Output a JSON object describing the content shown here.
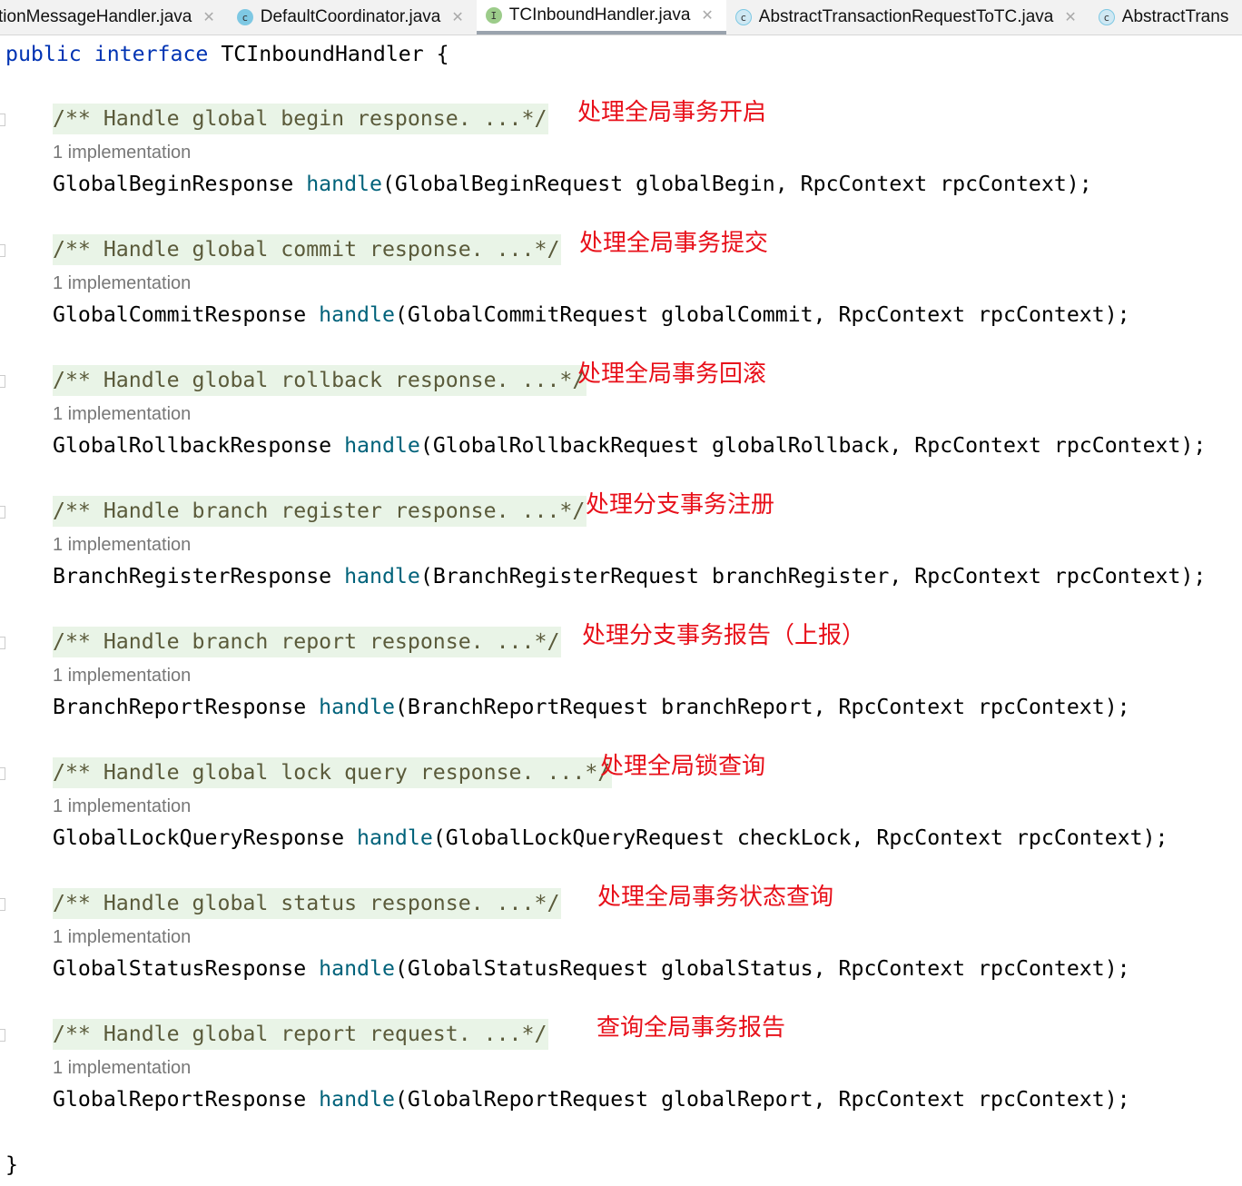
{
  "tabs": [
    {
      "label": "tionMessageHandler.java",
      "icon": "none",
      "active": false
    },
    {
      "label": "DefaultCoordinator.java",
      "icon": "c",
      "active": false
    },
    {
      "label": "TCInboundHandler.java",
      "icon": "i",
      "active": true
    },
    {
      "label": "AbstractTransactionRequestToTC.java",
      "icon": "ca",
      "active": false
    },
    {
      "label": "AbstractTrans",
      "icon": "ca",
      "active": false
    }
  ],
  "code": {
    "kw_public": "public",
    "kw_interface": "interface",
    "iface": " TCInboundHandler {",
    "close": "}",
    "impl_label": "1 implementation",
    "methods": [
      {
        "comment": "/** Handle global begin response. ...*/",
        "ret": "GlobalBeginResponse ",
        "name": "handle",
        "params": "(GlobalBeginRequest globalBegin, RpcContext rpcContext);",
        "note": "处理全局事务开启"
      },
      {
        "comment": "/** Handle global commit response. ...*/",
        "ret": "GlobalCommitResponse ",
        "name": "handle",
        "params": "(GlobalCommitRequest globalCommit, RpcContext rpcContext);",
        "note": "处理全局事务提交"
      },
      {
        "comment": "/** Handle global rollback response. ...*/",
        "ret": "GlobalRollbackResponse ",
        "name": "handle",
        "params": "(GlobalRollbackRequest globalRollback, RpcContext rpcContext);",
        "note": "处理全局事务回滚"
      },
      {
        "comment": "/** Handle branch register response. ...*/",
        "ret": "BranchRegisterResponse ",
        "name": "handle",
        "params": "(BranchRegisterRequest branchRegister, RpcContext rpcContext);",
        "note": "处理分支事务注册"
      },
      {
        "comment": "/** Handle branch report response. ...*/",
        "ret": "BranchReportResponse ",
        "name": "handle",
        "params": "(BranchReportRequest branchReport, RpcContext rpcContext);",
        "note": "处理分支事务报告（上报）"
      },
      {
        "comment": "/** Handle global lock query response. ...*/",
        "ret": "GlobalLockQueryResponse ",
        "name": "handle",
        "params": "(GlobalLockQueryRequest checkLock, RpcContext rpcContext);",
        "note": "处理全局锁查询"
      },
      {
        "comment": "/** Handle global status response. ...*/",
        "ret": "GlobalStatusResponse ",
        "name": "handle",
        "params": "(GlobalStatusRequest globalStatus, RpcContext rpcContext);",
        "note": "处理全局事务状态查询"
      },
      {
        "comment": "/** Handle global report request. ...*/",
        "ret": "GlobalReportResponse ",
        "name": "handle",
        "params": "(GlobalReportRequest globalReport, RpcContext rpcContext);",
        "note": "查询全局事务报告"
      }
    ]
  }
}
